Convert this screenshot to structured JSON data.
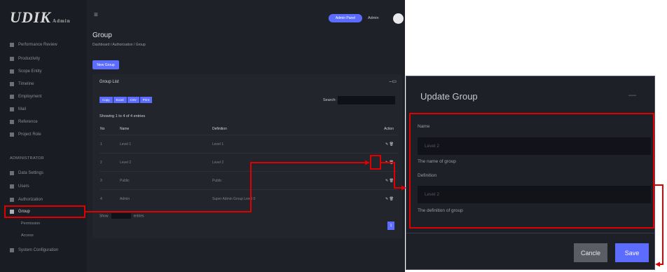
{
  "brand": {
    "logo_text": "UDIK",
    "logo_small": "Admin"
  },
  "sidebar": {
    "items": [
      {
        "label": "Performance Review"
      },
      {
        "label": "Productivity"
      },
      {
        "label": "Scope Entity"
      },
      {
        "label": "Timeline"
      },
      {
        "label": "Employment"
      },
      {
        "label": "Mail"
      },
      {
        "label": "Reference"
      },
      {
        "label": "Project Role"
      }
    ],
    "section": "ADMINISTRATOR",
    "admin_items": [
      {
        "label": "Data Settings"
      },
      {
        "label": "Users"
      },
      {
        "label": "Authorization"
      },
      {
        "label": "Group"
      }
    ],
    "sub_items": [
      "Permission",
      "Access"
    ],
    "bottom_item": "System Configuration"
  },
  "topbar": {
    "button": "Admin Panel",
    "username": "Admin"
  },
  "page": {
    "title": "Group",
    "breadcrumb": "Dashboard / Authorization / Group",
    "new_button": "New Group"
  },
  "card": {
    "title": "Group List",
    "export_buttons": [
      "Copy",
      "Excel",
      "CSV",
      "Print"
    ],
    "search_label": "Search:",
    "showing": "Showing 1 to 4 of 4 entries",
    "columns": [
      "No",
      "Name",
      "Definition",
      "Action"
    ],
    "rows": [
      {
        "no": "1",
        "name": "Level 1",
        "definition": "Level 1"
      },
      {
        "no": "2",
        "name": "Level 2",
        "definition": "Level 2"
      },
      {
        "no": "3",
        "name": "Public",
        "definition": "Public"
      },
      {
        "no": "4",
        "name": "Admin",
        "definition": "Super Admin Group Level 0"
      }
    ],
    "pager_show": "Show",
    "pager_entries": "entries",
    "page_number": "1"
  },
  "modal": {
    "title": "Update Group",
    "close": "—",
    "name_label": "Name",
    "name_value": "Level 2",
    "name_help": "The name of group",
    "def_label": "Definition",
    "def_value": "Level 2",
    "def_help": "The definition of group",
    "cancel": "Cancle",
    "save": "Save"
  }
}
